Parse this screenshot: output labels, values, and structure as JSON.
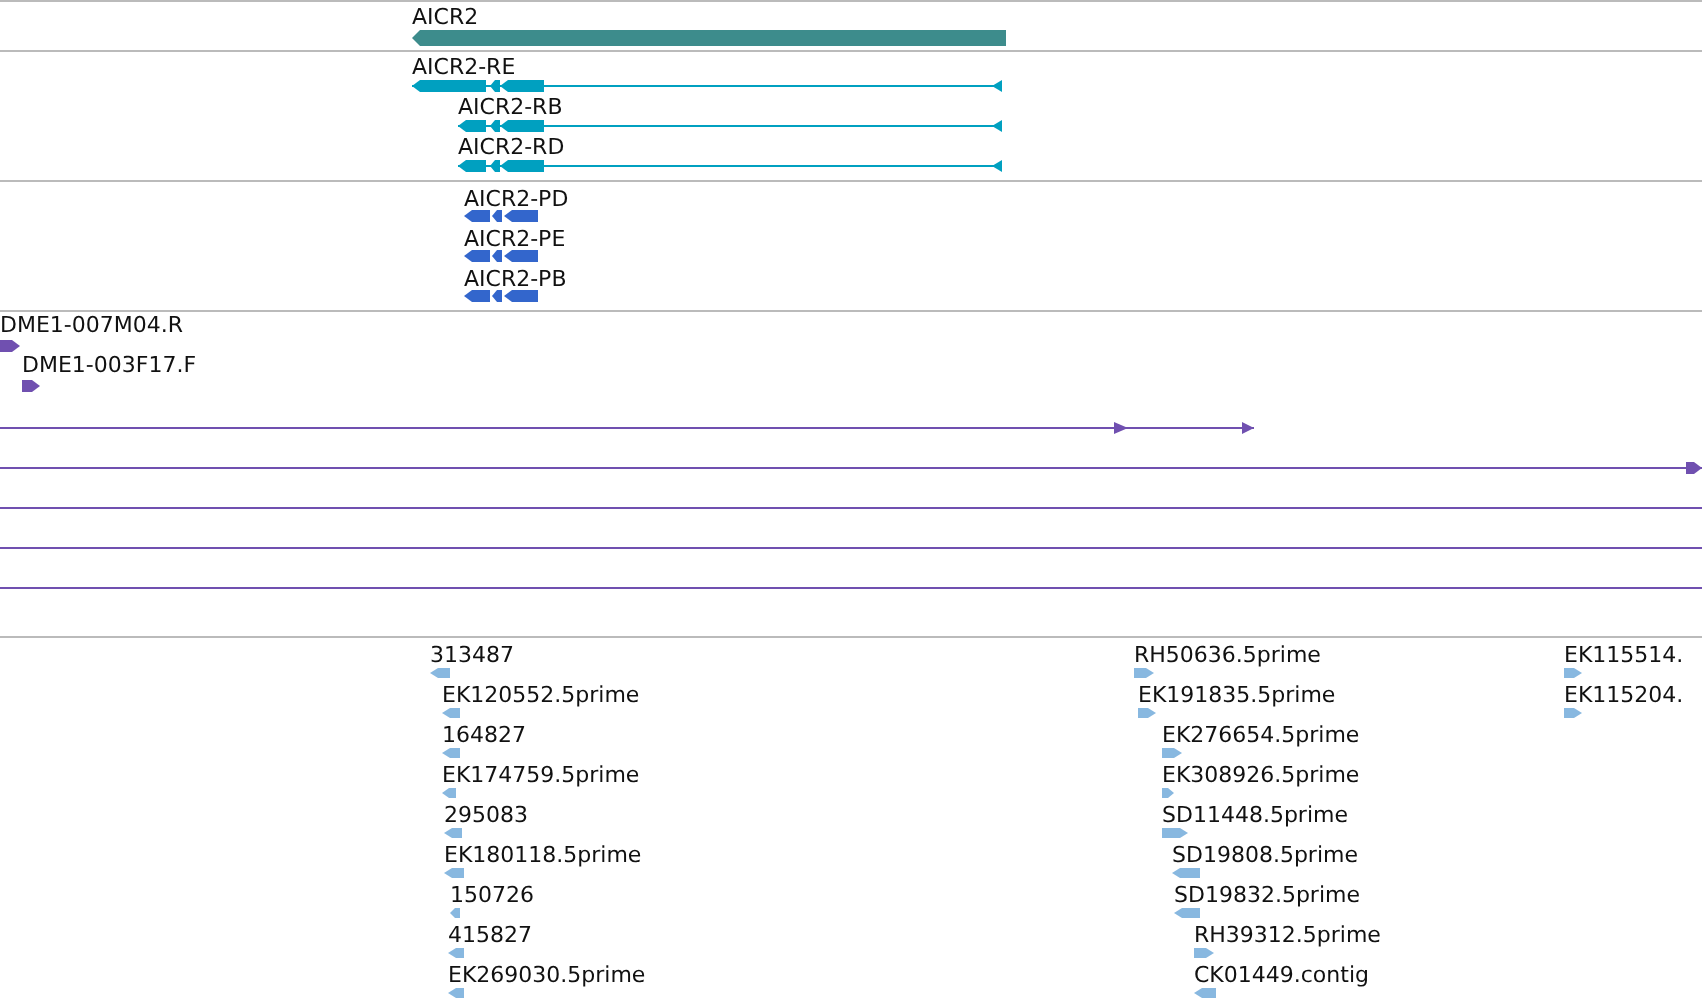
{
  "tracks": [
    {
      "kind": "gene",
      "color": "#3d8c8c",
      "features": [
        {
          "label": "AICR2",
          "reverse": true
        }
      ]
    },
    {
      "kind": "transcript",
      "color": "#00a0c0",
      "features": [
        {
          "label": "AICR2-RE",
          "reverse": true
        },
        {
          "label": "AICR2-RB",
          "reverse": true
        },
        {
          "label": "AICR2-RD",
          "reverse": true
        }
      ]
    },
    {
      "kind": "protein",
      "color": "#3366cc",
      "features": [
        {
          "label": "AICR2-PD",
          "reverse": true
        },
        {
          "label": "AICR2-PE",
          "reverse": true
        },
        {
          "label": "AICR2-PB",
          "reverse": true
        }
      ]
    },
    {
      "kind": "clone",
      "color": "#7050b0",
      "features": [
        {
          "kind": "read",
          "label": "DME1-007M04.R",
          "reverse": false
        },
        {
          "kind": "read",
          "label": "DME1-003F17.F",
          "reverse": false
        },
        {
          "kind": "span",
          "arrows": true,
          "reverse": false
        },
        {
          "kind": "span",
          "arrows": true,
          "reverse": false
        },
        {
          "kind": "span",
          "arrows": false
        },
        {
          "kind": "span",
          "arrows": false
        },
        {
          "kind": "span",
          "arrows": false
        }
      ]
    },
    {
      "kind": "est",
      "color": "#88b8e0",
      "features": [
        {
          "label": "313487",
          "reverse": true
        },
        {
          "label": "EK120552.5prime",
          "reverse": true
        },
        {
          "label": "164827",
          "reverse": true
        },
        {
          "label": "EK174759.5prime",
          "reverse": true
        },
        {
          "label": "295083",
          "reverse": true
        },
        {
          "label": "EK180118.5prime",
          "reverse": true
        },
        {
          "label": "150726",
          "reverse": true
        },
        {
          "label": "415827",
          "reverse": true
        },
        {
          "label": "EK269030.5prime",
          "reverse": true
        },
        {
          "label": "RH50636.5prime",
          "reverse": false
        },
        {
          "label": "EK191835.5prime",
          "reverse": false
        },
        {
          "label": "EK276654.5prime",
          "reverse": false
        },
        {
          "label": "EK308926.5prime",
          "reverse": false
        },
        {
          "label": "SD11448.5prime",
          "reverse": false
        },
        {
          "label": "SD19808.5prime",
          "reverse": true
        },
        {
          "label": "SD19832.5prime",
          "reverse": true
        },
        {
          "label": "RH39312.5prime",
          "reverse": false
        },
        {
          "label": "CK01449.contig",
          "reverse": true
        },
        {
          "label": "EK115514.",
          "reverse": false
        },
        {
          "label": "EK115204.",
          "reverse": false
        }
      ]
    }
  ]
}
